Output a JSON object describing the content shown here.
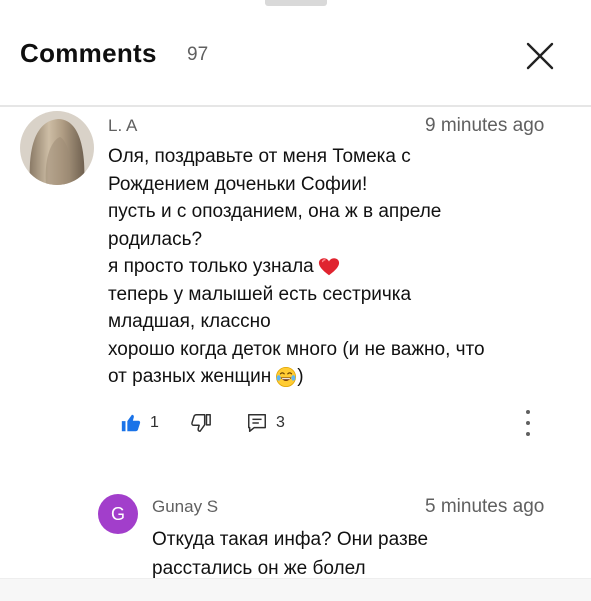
{
  "header": {
    "title": "Comments",
    "count": "97"
  },
  "comments": [
    {
      "author": "L. A",
      "time": "9 minutes ago",
      "lines": [
        "Оля, поздравьте от меня Томека с",
        "Рождением доченьки Софии!",
        "пусть и с опозданием, она ж в апреле",
        "родилась?",
        "я просто только узнала",
        "теперь у малышей есть сестричка",
        "младшая, классно",
        "хорошо когда деток много (и не важно, что",
        "от разных женщин"
      ],
      "line_end_suffix": ")",
      "emoji_names": [
        "red-heart-emoji",
        "tears-of-joy-emoji"
      ],
      "likes": "1",
      "replies": "3"
    }
  ],
  "replies": [
    {
      "avatar_letter": "G",
      "avatar_color": "#a23ecb",
      "author": "Gunay S",
      "time": "5 minutes ago",
      "lines": [
        "Откуда такая инфа? Они разве",
        "расстались он же болел"
      ]
    }
  ],
  "colors": {
    "like_active": "#1a73e8",
    "secondary_text": "#606060"
  },
  "icons": [
    "close-icon",
    "thumbs-up-icon",
    "thumbs-down-icon",
    "reply-icon",
    "more-vert-icon"
  ]
}
